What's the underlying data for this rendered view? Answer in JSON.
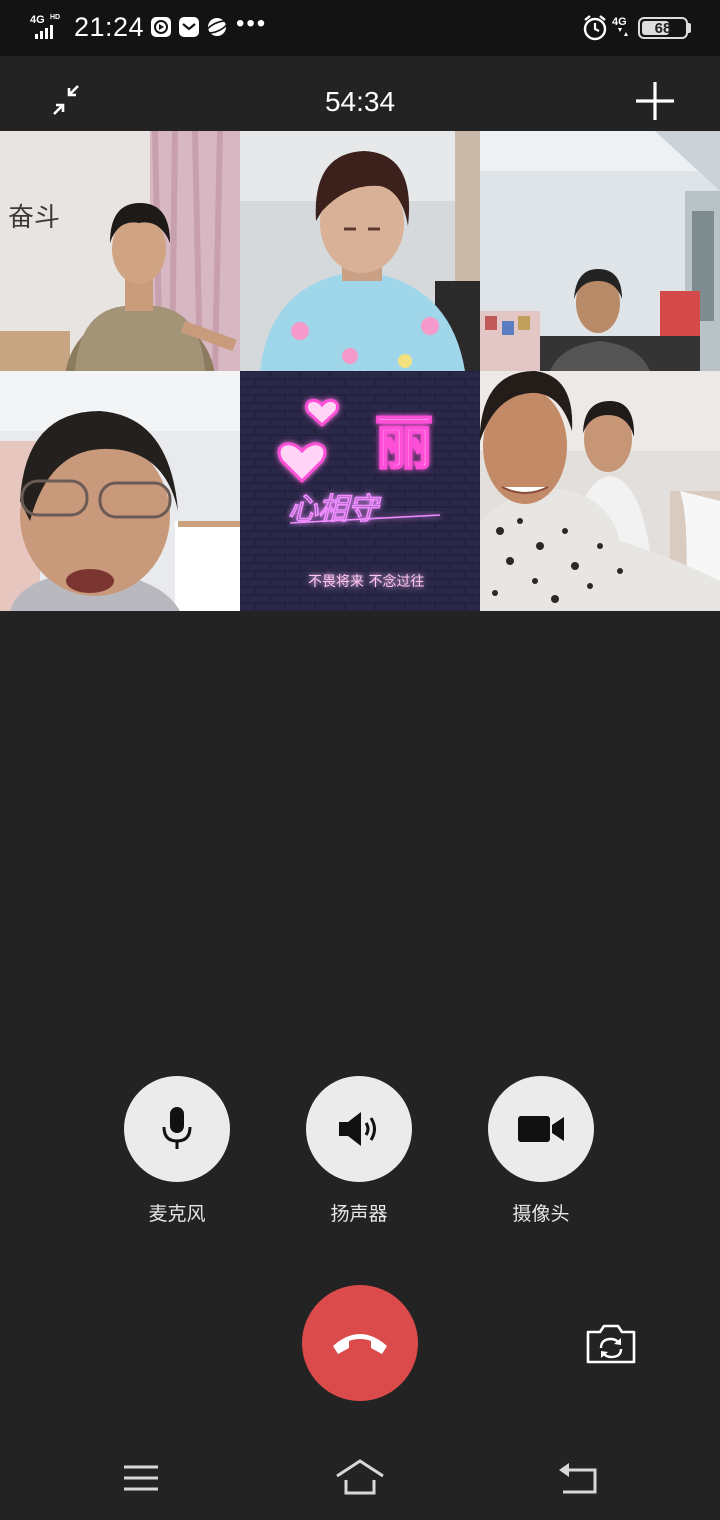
{
  "status_bar": {
    "network": "4G",
    "network_hd": "HD",
    "time": "21:24",
    "overflow": "•••",
    "secondary_network": "4G",
    "battery": "68",
    "battery_level_pct": 68,
    "icons": [
      "signal-icon",
      "video-app-icon",
      "message-icon",
      "browser-icon",
      "alarm-icon",
      "battery-icon"
    ]
  },
  "header": {
    "timer": "54:34",
    "minimize_icon": "collapse-arrows-icon",
    "add_icon": "plus-icon"
  },
  "video_tiles": [
    {
      "id": "participant-1",
      "wall_text": "奋斗"
    },
    {
      "id": "participant-2"
    },
    {
      "id": "participant-3"
    },
    {
      "id": "participant-4"
    },
    {
      "id": "participant-5",
      "avatar_title": "丽",
      "avatar_signature": "心相守",
      "avatar_slogan": "不畏将来 不念过往"
    },
    {
      "id": "participant-6"
    }
  ],
  "controls": {
    "microphone": {
      "label": "麦克风",
      "icon": "microphone-icon"
    },
    "speaker": {
      "label": "扬声器",
      "icon": "speaker-icon"
    },
    "camera": {
      "label": "摄像头",
      "icon": "video-camera-icon"
    }
  },
  "actions": {
    "hangup_icon": "hang-up-icon",
    "switch_camera_icon": "switch-camera-icon"
  },
  "nav_bar": {
    "icons": [
      "menu-icon",
      "home-icon",
      "back-icon"
    ]
  },
  "colors": {
    "background": "#232323",
    "status_bar": "#131313",
    "control_button": "#ebebeb",
    "hangup": "#db4b4b"
  }
}
